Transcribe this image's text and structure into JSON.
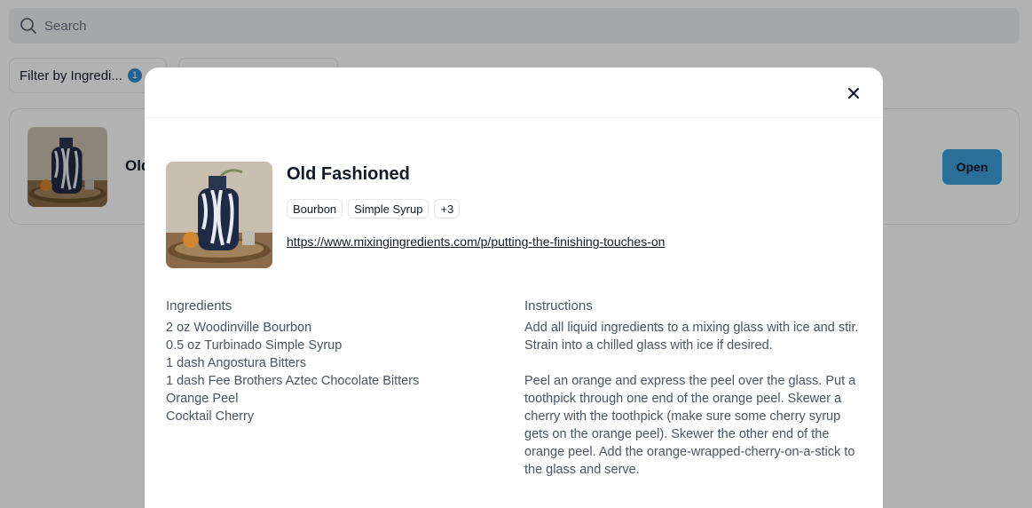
{
  "search": {
    "placeholder": "Search"
  },
  "filters": {
    "ingredient_label": "Filter by Ingredi...",
    "ingredient_count": "1"
  },
  "recipe_card": {
    "title": "Old Fashioned",
    "open_label": "Open"
  },
  "modal": {
    "title": "Old Fashioned",
    "tags": [
      "Bourbon",
      "Simple Syrup",
      "+3"
    ],
    "link": "https://www.mixingingredients.com/p/putting-the-finishing-touches-on",
    "ingredients_heading": "Ingredients",
    "ingredients": [
      "2 oz Woodinville Bourbon",
      "0.5 oz Turbinado Simple Syrup",
      "1 dash Angostura Bitters",
      "1 dash Fee Brothers Aztec Chocolate Bitters",
      "Orange Peel",
      "Cocktail Cherry"
    ],
    "instructions_heading": "Instructions",
    "instructions": [
      "Add all liquid ingredients to a mixing glass with ice and stir. Strain into a chilled glass with ice if desired.",
      "Peel an orange and express the peel over the glass. Put a toothpick through one end of the orange peel. Skewer a cherry with the toothpick (make sure some cherry syrup gets on the orange peel). Skewer the other end of the orange peel. Add the orange-wrapped-cherry-on-a-stick to the glass and serve."
    ]
  },
  "icons": {
    "search": "search-icon",
    "close": "close-icon"
  },
  "colors": {
    "accent": "#3d9fd8",
    "badge": "#2f8fd0"
  }
}
